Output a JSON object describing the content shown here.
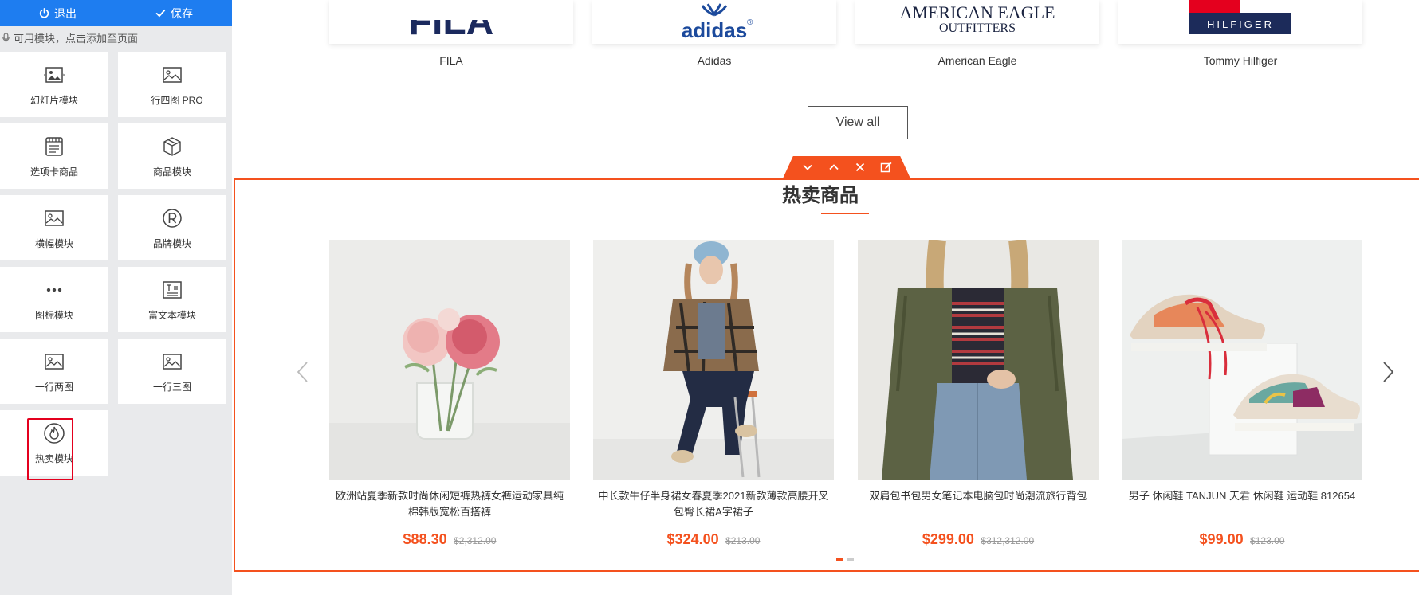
{
  "toolbar": {
    "exit_label": "退出",
    "save_label": "保存"
  },
  "sidebar": {
    "hint": "可用模块，点击添加至页面",
    "modules": [
      {
        "label": "幻灯片模块",
        "icon": "slideshow-icon"
      },
      {
        "label": "一行四图 PRO",
        "icon": "image-icon"
      },
      {
        "label": "选项卡商品",
        "icon": "tab-list-icon"
      },
      {
        "label": "商品模块",
        "icon": "box-icon"
      },
      {
        "label": "横幅模块",
        "icon": "image-icon"
      },
      {
        "label": "品牌模块",
        "icon": "registered-icon"
      },
      {
        "label": "图标模块",
        "icon": "dots-icon"
      },
      {
        "label": "富文本模块",
        "icon": "rich-text-icon"
      },
      {
        "label": "一行两图",
        "icon": "image-icon"
      },
      {
        "label": "一行三图",
        "icon": "image-icon"
      },
      {
        "label": "热卖模块",
        "icon": "flame-icon"
      }
    ]
  },
  "brands": [
    {
      "name": "FILA",
      "logo_text": "FILA"
    },
    {
      "name": "Adidas",
      "logo_text": "adidas"
    },
    {
      "name": "American Eagle",
      "logo_text": "AMERICAN EAGLE",
      "logo_text2": "OUTFITTERS"
    },
    {
      "name": "Tommy Hilfiger",
      "logo_text": "HILFIGER"
    }
  ],
  "view_all_label": "View all",
  "hot": {
    "title": "热卖商品",
    "products": [
      {
        "name": "欧洲站夏季新款时尚休闲短裤热裤女裤运动家具纯棉韩版宽松百搭裤",
        "price": "$88.30",
        "old_price": "$2,312.00"
      },
      {
        "name": "中长款牛仔半身裙女春夏季2021新款薄款高腰开叉包臀长裙A字裙子",
        "price": "$324.00",
        "old_price": "$213.00"
      },
      {
        "name": "双肩包书包男女笔记本电脑包时尚潮流旅行背包",
        "price": "$299.00",
        "old_price": "$312,312.00"
      },
      {
        "name": "男子 休闲鞋 TANJUN 天君 休闲鞋 运动鞋 812654",
        "price": "$99.00",
        "old_price": "$123.00"
      }
    ],
    "active_page": 1,
    "page_count": 2
  },
  "colors": {
    "accent": "#f4511e",
    "primary": "#1e7df0",
    "highlight": "#e4001e"
  }
}
